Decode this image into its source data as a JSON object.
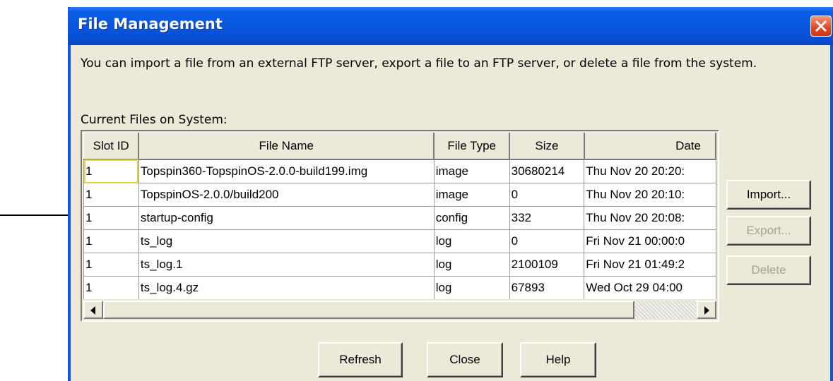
{
  "window": {
    "title": "File Management",
    "description": "You can import a file from an external FTP server, export a file to an FTP server, or delete a file from the system.",
    "files_label": "Current Files on System:"
  },
  "table": {
    "columns": [
      "Slot ID",
      "File Name",
      "File Type",
      "Size",
      "Date"
    ],
    "rows": [
      {
        "slot": "1",
        "name": "Topspin360-TopspinOS-2.0.0-build199.img",
        "type": "image",
        "size": "30680214",
        "date": "Thu Nov 20 20:20:"
      },
      {
        "slot": "1",
        "name": "TopspinOS-2.0.0/build200",
        "type": "image",
        "size": "0",
        "date": "Thu Nov 20 20:10:"
      },
      {
        "slot": "1",
        "name": "startup-config",
        "type": "config",
        "size": "332",
        "date": "Thu Nov 20 20:08:"
      },
      {
        "slot": "1",
        "name": "ts_log",
        "type": "log",
        "size": "0",
        "date": "Fri Nov 21 00:00:0"
      },
      {
        "slot": "1",
        "name": "ts_log.1",
        "type": "log",
        "size": "2100109",
        "date": "Fri Nov 21 01:49:2"
      },
      {
        "slot": "1",
        "name": "ts_log.4.gz",
        "type": "log",
        "size": "67893",
        "date": "Wed Oct 29 04:00"
      }
    ]
  },
  "side_buttons": {
    "import": "Import...",
    "export": "Export...",
    "delete": "Delete"
  },
  "bottom_buttons": {
    "refresh": "Refresh",
    "close": "Close",
    "help": "Help"
  },
  "icons": {
    "close": "close-icon",
    "arrow": "pointer-arrow-icon",
    "scroll_left": "arrow-left-icon",
    "scroll_right": "arrow-right-icon"
  },
  "colors": {
    "titlebar": "#0a58e0",
    "close_button": "#e2451f",
    "dialog_bg": "#ece9d8",
    "selection_outline": "#e8d24a"
  }
}
